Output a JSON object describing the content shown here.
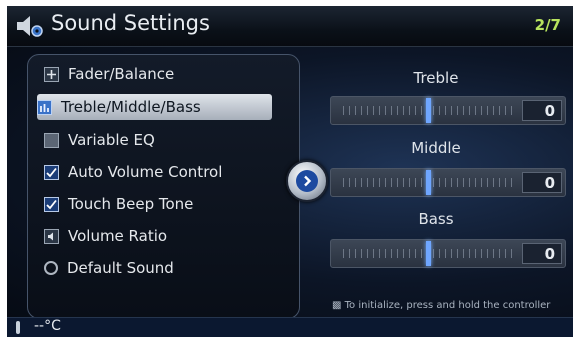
{
  "header": {
    "title": "Sound Settings",
    "page": "2/7"
  },
  "menu": {
    "items": [
      {
        "label": "Fader/Balance",
        "icon": "fader-balance-icon"
      },
      {
        "label": "Treble/Middle/Bass",
        "icon": "equalizer-icon"
      },
      {
        "label": "Variable EQ",
        "icon": "checkbox-icon"
      },
      {
        "label": "Auto Volume Control",
        "icon": "checkbox-checked-icon"
      },
      {
        "label": "Touch Beep Tone",
        "icon": "checkbox-checked-icon"
      },
      {
        "label": "Volume Ratio",
        "icon": "volume-ratio-icon"
      },
      {
        "label": "Default Sound",
        "icon": "default-sound-icon"
      }
    ],
    "selected_index": 1
  },
  "tone": {
    "treble": {
      "label": "Treble",
      "value": "0",
      "level": 0.5
    },
    "middle": {
      "label": "Middle",
      "value": "0",
      "level": 0.5
    },
    "bass": {
      "label": "Bass",
      "value": "0",
      "level": 0.5
    }
  },
  "hint": "To initialize, press and hold the controller",
  "status": {
    "temperature": "--°C"
  },
  "colors": {
    "page_indicator": "#b9e45e",
    "slider_knob": "#6fa6ff",
    "selected_item": "#dfe4ea"
  }
}
